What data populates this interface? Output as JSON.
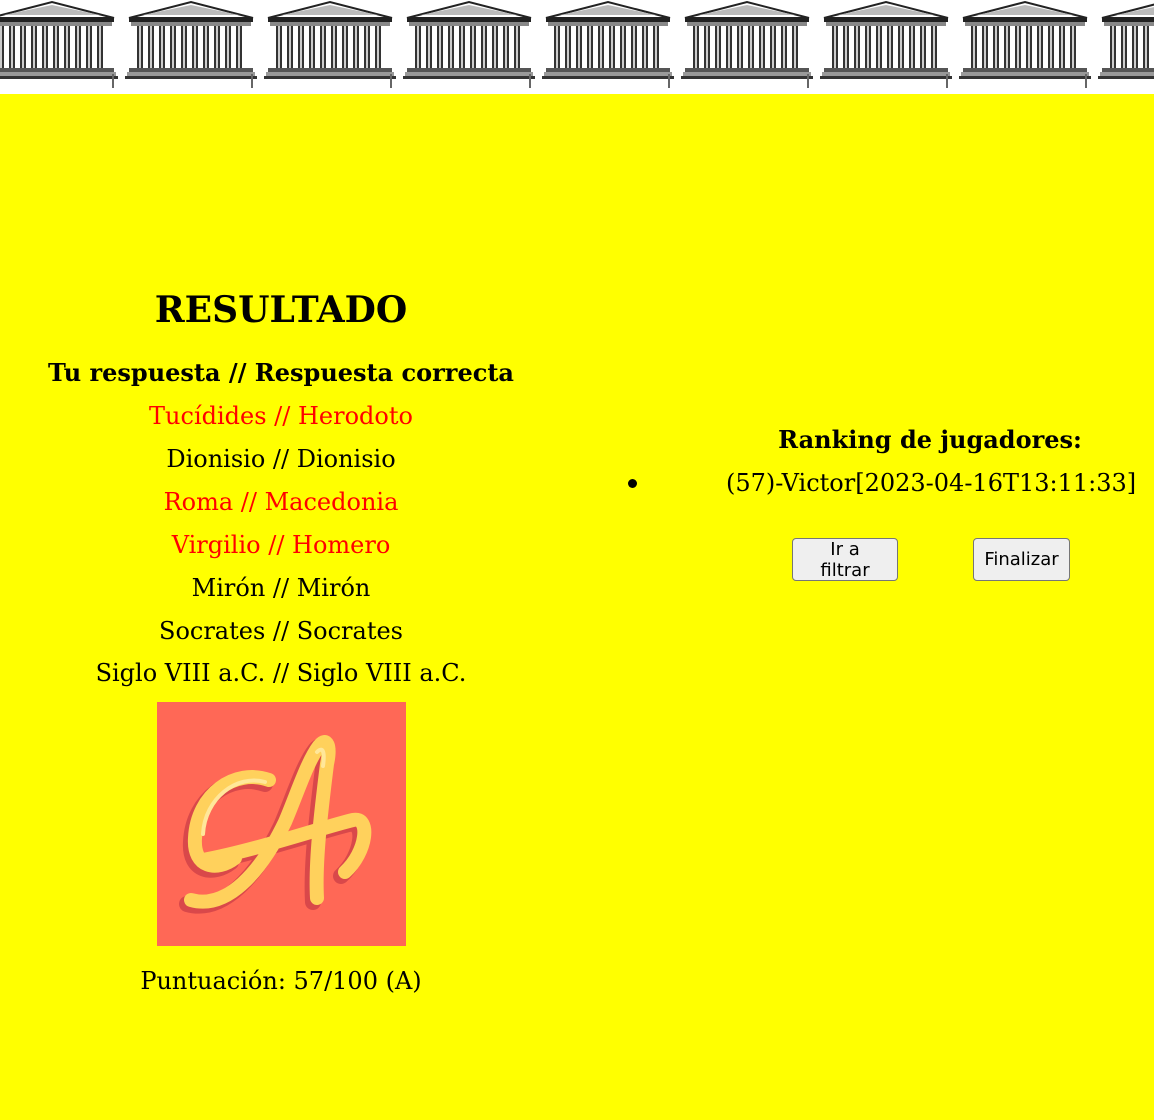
{
  "banner": {
    "icon": "greek-temple-icon"
  },
  "result": {
    "title": "RESULTADO",
    "header": "Tu respuesta // Respuesta correcta",
    "answers": [
      {
        "text": "Tucídides // Herodoto",
        "status": "wrong"
      },
      {
        "text": "Dionisio // Dionisio",
        "status": "correct"
      },
      {
        "text": "Roma // Macedonia",
        "status": "wrong"
      },
      {
        "text": "Virgilio // Homero",
        "status": "wrong"
      },
      {
        "text": "Mirón // Mirón",
        "status": "correct"
      },
      {
        "text": "Socrates // Socrates",
        "status": "correct"
      },
      {
        "text": "Siglo VIII a.C. // Siglo VIII a.C.",
        "status": "correct"
      }
    ],
    "grade_image": {
      "icon": "grade-a-letter-icon",
      "letter": "A"
    },
    "score_text": "Puntuación: 57/100 (A)"
  },
  "ranking": {
    "title": "Ranking de jugadores:",
    "entries": [
      "(57)-Victor[2023-04-16T13:11:33]"
    ]
  },
  "buttons": {
    "filter_label": "Ir a filtrar",
    "finish_label": "Finalizar"
  },
  "colors": {
    "background": "#ffff00",
    "wrong_answer": "#ff0000",
    "correct_answer": "#000000",
    "grade_tile": "#ff6856",
    "grade_letter": "#ffd15c"
  }
}
